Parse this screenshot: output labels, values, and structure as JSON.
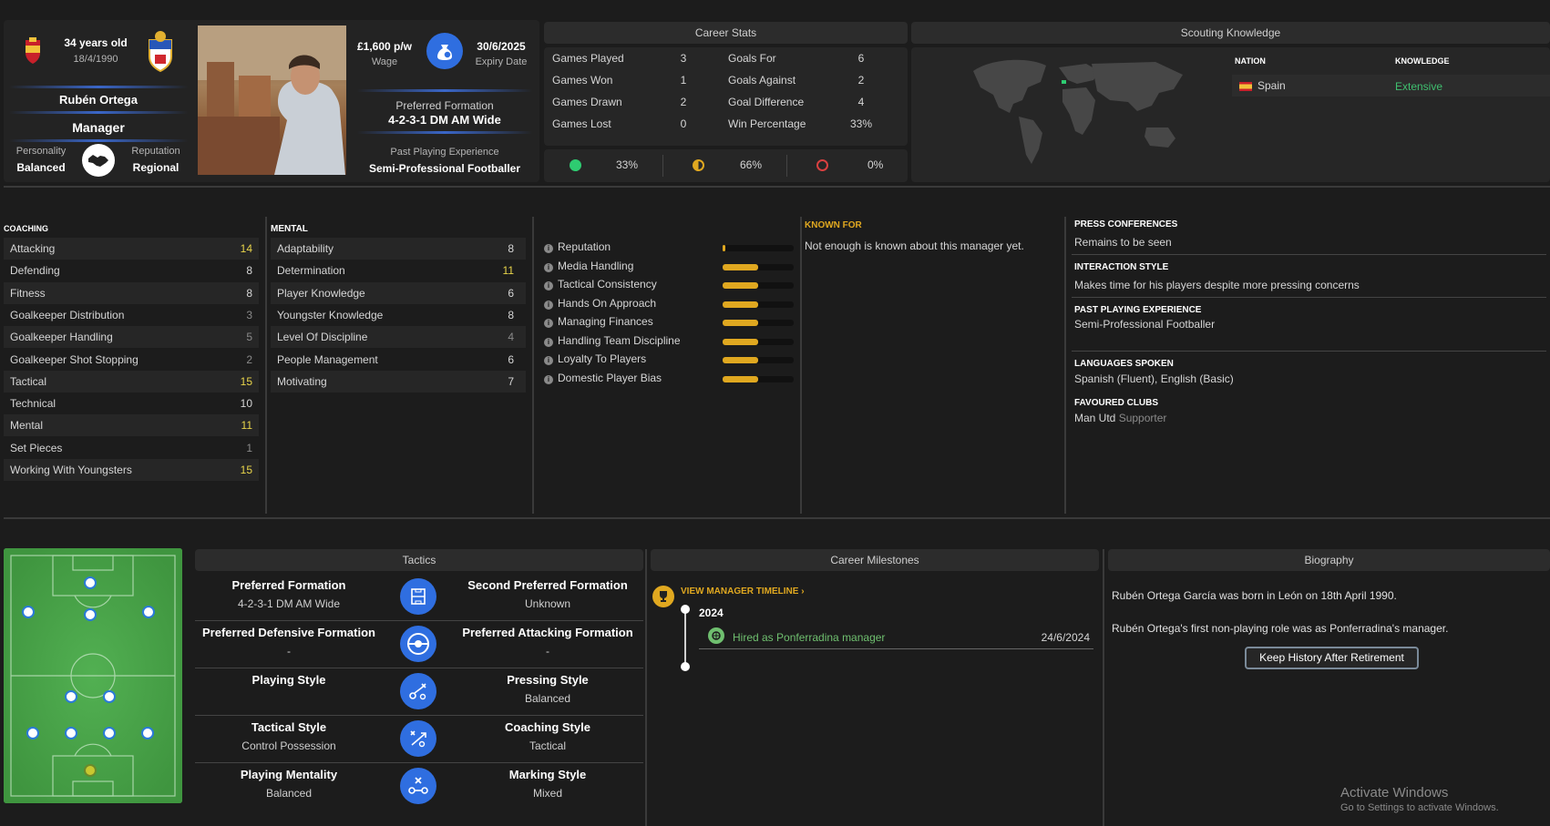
{
  "profile": {
    "age": "34 years old",
    "dob": "18/4/1990",
    "name": "Rubén Ortega",
    "role": "Manager",
    "personality_label": "Personality",
    "personality": "Balanced",
    "reputation_label": "Reputation",
    "reputation": "Regional",
    "wage": "£1,600 p/w",
    "wage_label": "Wage",
    "expiry": "30/6/2025",
    "expiry_label": "Expiry Date",
    "formation_label": "Preferred Formation",
    "formation": "4-2-3-1 DM AM Wide",
    "experience_label": "Past Playing Experience",
    "experience": "Semi-Professional Footballer"
  },
  "career_stats": {
    "title": "Career Stats",
    "left": [
      {
        "label": "Games Played",
        "value": "3"
      },
      {
        "label": "Games Won",
        "value": "1"
      },
      {
        "label": "Games Drawn",
        "value": "2"
      },
      {
        "label": "Games Lost",
        "value": "0"
      }
    ],
    "right": [
      {
        "label": "Goals For",
        "value": "6"
      },
      {
        "label": "Goals Against",
        "value": "2"
      },
      {
        "label": "Goal Difference",
        "value": "4"
      },
      {
        "label": "Win Percentage",
        "value": "33%"
      }
    ],
    "pct_win": "33%",
    "pct_draw": "66%",
    "pct_loss": "0%",
    "colors": {
      "win": "#2ecc71",
      "draw": "#e0a820",
      "loss": "#d94040"
    }
  },
  "scouting": {
    "title": "Scouting Knowledge",
    "nation_header": "NATION",
    "knowledge_header": "KNOWLEDGE",
    "nation": "Spain",
    "knowledge": "Extensive"
  },
  "coaching": {
    "title": "COACHING",
    "items": [
      {
        "label": "Attacking",
        "value": "14",
        "tone": "yellow"
      },
      {
        "label": "Defending",
        "value": "8",
        "tone": "white"
      },
      {
        "label": "Fitness",
        "value": "8",
        "tone": "white"
      },
      {
        "label": "Goalkeeper Distribution",
        "value": "3",
        "tone": "gray"
      },
      {
        "label": "Goalkeeper Handling",
        "value": "5",
        "tone": "gray"
      },
      {
        "label": "Goalkeeper Shot Stopping",
        "value": "2",
        "tone": "gray"
      },
      {
        "label": "Tactical",
        "value": "15",
        "tone": "yellow"
      },
      {
        "label": "Technical",
        "value": "10",
        "tone": "white"
      },
      {
        "label": "Mental",
        "value": "11",
        "tone": "yellow"
      },
      {
        "label": "Set Pieces",
        "value": "1",
        "tone": "gray"
      },
      {
        "label": "Working With Youngsters",
        "value": "15",
        "tone": "yellow"
      }
    ]
  },
  "mental": {
    "title": "MENTAL",
    "items": [
      {
        "label": "Adaptability",
        "value": "8",
        "tone": "white"
      },
      {
        "label": "Determination",
        "value": "11",
        "tone": "yellow"
      },
      {
        "label": "Player Knowledge",
        "value": "6",
        "tone": "white"
      },
      {
        "label": "Youngster Knowledge",
        "value": "8",
        "tone": "white"
      },
      {
        "label": "Level Of Discipline",
        "value": "4",
        "tone": "gray"
      },
      {
        "label": "People Management",
        "value": "6",
        "tone": "white"
      },
      {
        "label": "Motivating",
        "value": "7",
        "tone": "white"
      }
    ]
  },
  "traits": [
    {
      "label": "Reputation",
      "level": 0.04
    },
    {
      "label": "Media Handling",
      "level": 0.5
    },
    {
      "label": "Tactical Consistency",
      "level": 0.5
    },
    {
      "label": "Hands On Approach",
      "level": 0.5
    },
    {
      "label": "Managing Finances",
      "level": 0.5
    },
    {
      "label": "Handling Team Discipline",
      "level": 0.5
    },
    {
      "label": "Loyalty To Players",
      "level": 0.5
    },
    {
      "label": "Domestic Player Bias",
      "level": 0.5
    }
  ],
  "known_for": {
    "title": "KNOWN FOR",
    "text": "Not enough is known about this manager yet."
  },
  "info": {
    "press_title": "PRESS CONFERENCES",
    "press": "Remains to be seen",
    "interaction_title": "INTERACTION STYLE",
    "interaction": "Makes time for his players despite more pressing concerns",
    "experience_title": "PAST PLAYING EXPERIENCE",
    "experience": "Semi-Professional Footballer",
    "languages_title": "LANGUAGES SPOKEN",
    "languages": "Spanish (Fluent), English (Basic)",
    "clubs_title": "FAVOURED CLUBS",
    "club": "Man Utd",
    "club_status": "Supporter"
  },
  "tactics": {
    "title": "Tactics",
    "rows": [
      {
        "l_title": "Preferred Formation",
        "l_value": "4-2-3-1 DM AM Wide",
        "r_title": "Second Preferred Formation",
        "r_value": "Unknown",
        "icon": "pitch-icon"
      },
      {
        "l_title": "Preferred Defensive Formation",
        "l_value": "-",
        "r_title": "Preferred Attacking Formation",
        "r_value": "-",
        "icon": "target-icon"
      },
      {
        "l_title": "Playing Style",
        "l_value": "",
        "r_title": "Pressing Style",
        "r_value": "Balanced",
        "icon": "play-arrows-icon"
      },
      {
        "l_title": "Tactical Style",
        "l_value": "Control Possession",
        "r_title": "Coaching Style",
        "r_value": "Tactical",
        "icon": "tactic-board-icon"
      },
      {
        "l_title": "Playing Mentality",
        "l_value": "Balanced",
        "r_title": "Marking Style",
        "r_value": "Mixed",
        "icon": "marking-icon"
      }
    ]
  },
  "milestones": {
    "title": "Career Milestones",
    "link": "VIEW MANAGER TIMELINE",
    "year": "2024",
    "event": "Hired as Ponferradina manager",
    "date": "24/6/2024"
  },
  "biography": {
    "title": "Biography",
    "line1": "Rubén Ortega García was born in León on 18th April 1990.",
    "line2": "Rubén Ortega's first non-playing role was as Ponferradina's manager.",
    "button": "Keep History After Retirement"
  },
  "watermark": {
    "line1": "Activate Windows",
    "line2": "Go to Settings to activate Windows."
  }
}
